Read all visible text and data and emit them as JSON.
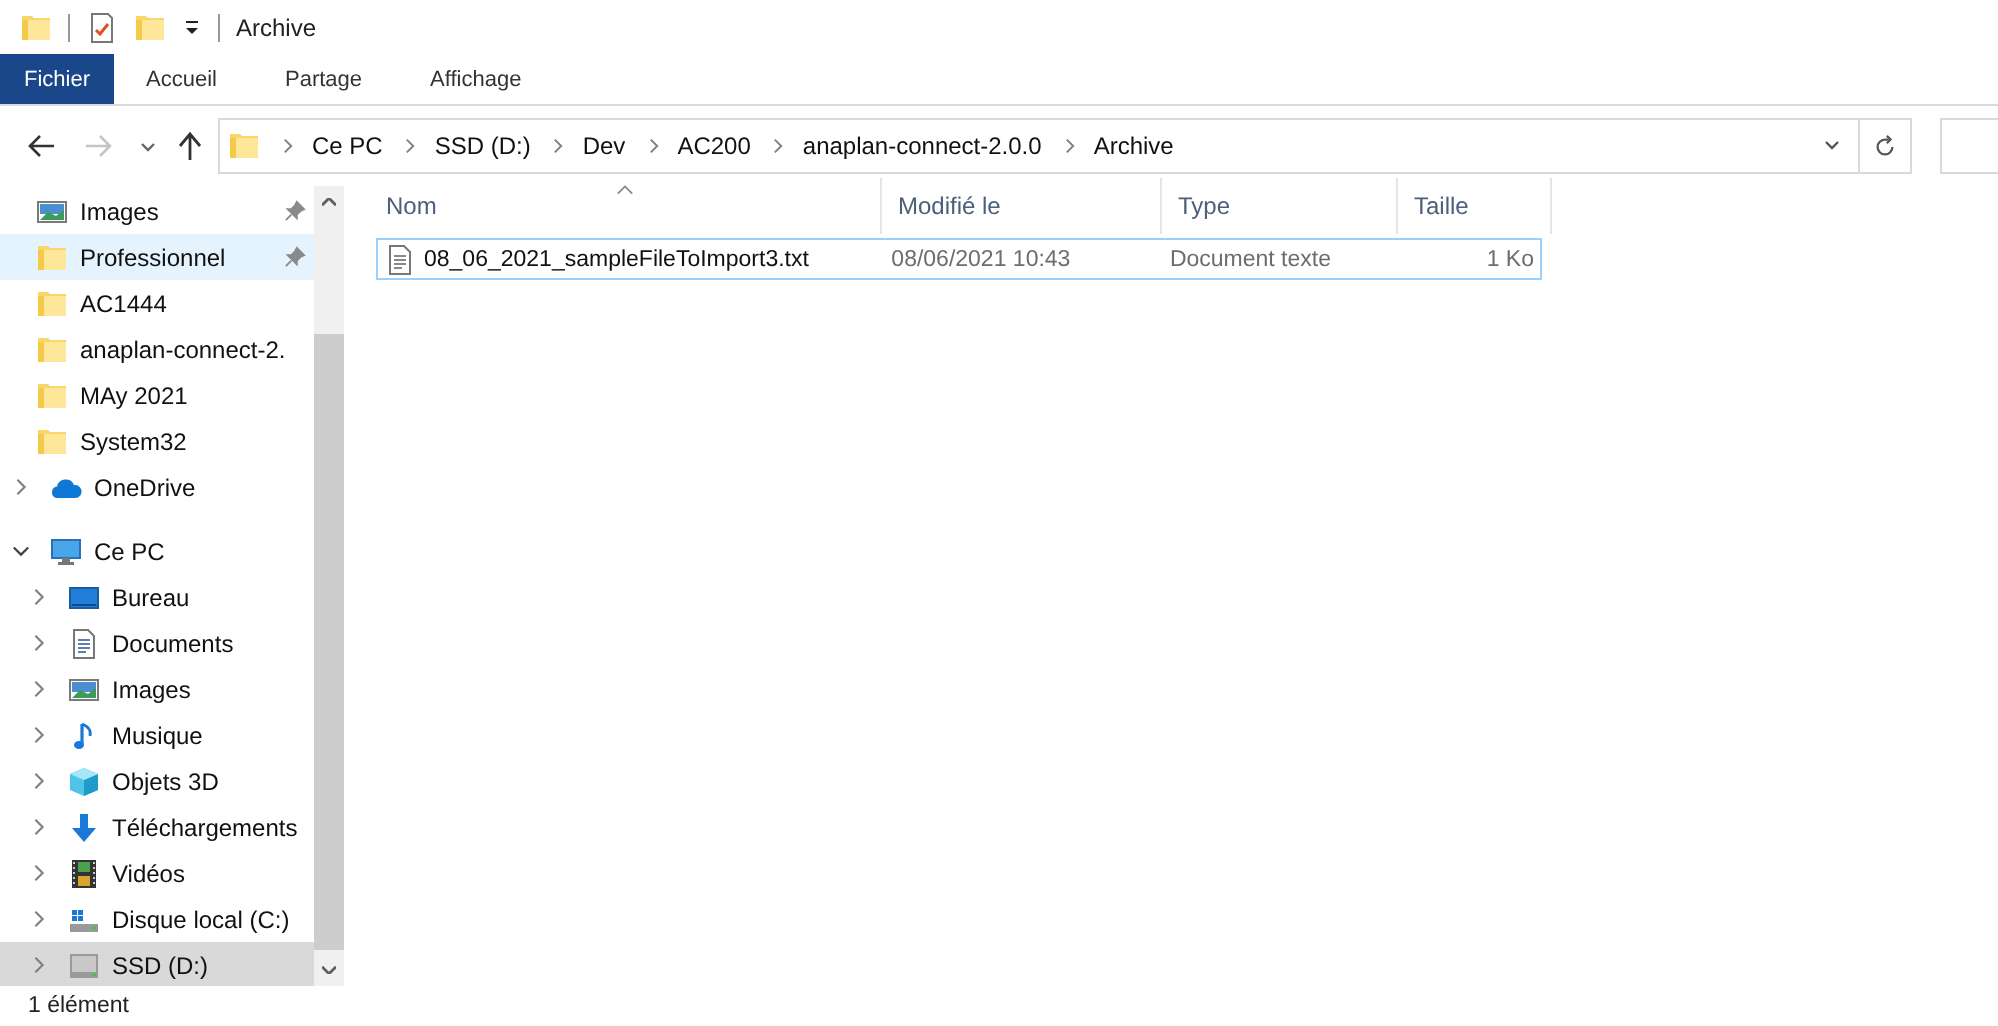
{
  "window": {
    "title": "Archive"
  },
  "ribbon_tabs": [
    {
      "label": "Fichier",
      "selected": true
    },
    {
      "label": "Accueil",
      "selected": false
    },
    {
      "label": "Partage",
      "selected": false
    },
    {
      "label": "Affichage",
      "selected": false
    }
  ],
  "navigation": {
    "back_disabled": false,
    "forward_disabled": true
  },
  "address": {
    "breadcrumbs": [
      "Ce PC",
      "SSD (D:)",
      "Dev",
      "AC200",
      "anaplan-connect-2.0.0",
      "Archive"
    ]
  },
  "sidebar": {
    "items": [
      {
        "label": "Images",
        "pinned": true,
        "hovered": false,
        "selected": false
      },
      {
        "label": "Professionnel",
        "pinned": true,
        "hovered": true,
        "selected": false
      },
      {
        "label": "AC1444",
        "pinned": false,
        "hovered": false,
        "selected": false
      },
      {
        "label": "anaplan-connect-2.",
        "pinned": false,
        "hovered": false,
        "selected": false
      },
      {
        "label": "MAy 2021",
        "pinned": false,
        "hovered": false,
        "selected": false
      },
      {
        "label": "System32",
        "pinned": false,
        "hovered": false,
        "selected": false
      },
      {
        "label": "OneDrive",
        "expanded": false,
        "hovered": false,
        "selected": false
      },
      {
        "label": "Ce PC",
        "expanded": true,
        "hovered": false,
        "selected": false,
        "children": [
          {
            "label": "Bureau",
            "expanded": false,
            "hovered": false,
            "selected": false
          },
          {
            "label": "Documents",
            "expanded": false,
            "hovered": false,
            "selected": false
          },
          {
            "label": "Images",
            "expanded": false,
            "hovered": false,
            "selected": false
          },
          {
            "label": "Musique",
            "expanded": false,
            "hovered": false,
            "selected": false
          },
          {
            "label": "Objets 3D",
            "expanded": false,
            "hovered": false,
            "selected": false
          },
          {
            "label": "Téléchargements",
            "expanded": false,
            "hovered": false,
            "selected": false
          },
          {
            "label": "Vidéos",
            "expanded": false,
            "hovered": false,
            "selected": false
          },
          {
            "label": "Disque local (C:)",
            "expanded": false,
            "hovered": false,
            "selected": false
          },
          {
            "label": "SSD (D:)",
            "expanded": false,
            "hovered": false,
            "selected": true
          }
        ]
      }
    ]
  },
  "table": {
    "columns": [
      {
        "label": "Nom",
        "sorted": true
      },
      {
        "label": "Modifié le",
        "sorted": false
      },
      {
        "label": "Type",
        "sorted": false
      },
      {
        "label": "Taille",
        "sorted": false
      }
    ],
    "rows": [
      {
        "name": "08_06_2021_sampleFileToImport3.txt",
        "modified": "08/06/2021 10:43",
        "type": "Document texte",
        "size": "1 Ko",
        "selected": true
      }
    ]
  },
  "status_bar": {
    "text": "1 élément"
  }
}
